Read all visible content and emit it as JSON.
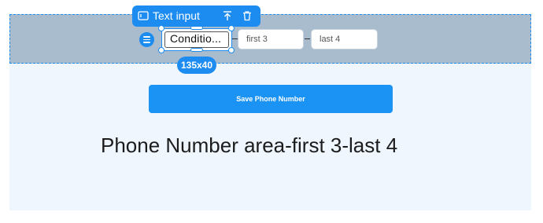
{
  "toolbar": {
    "label": "Text input",
    "icons": [
      "text-input-icon",
      "move-up-icon",
      "trash-icon"
    ]
  },
  "row": {
    "selected_field_text": "Conditio...",
    "size_badge": "135x40",
    "first_field_placeholder": "first 3",
    "last_field_placeholder": "last 4"
  },
  "save_button": {
    "label": "Save Phone Number"
  },
  "headline": "Phone Number area-first 3-last 4",
  "colors": {
    "accent": "#1d8cf0",
    "row_band": "#a9bcce",
    "canvas": "#eff6fe",
    "button": "#1b93f5"
  }
}
